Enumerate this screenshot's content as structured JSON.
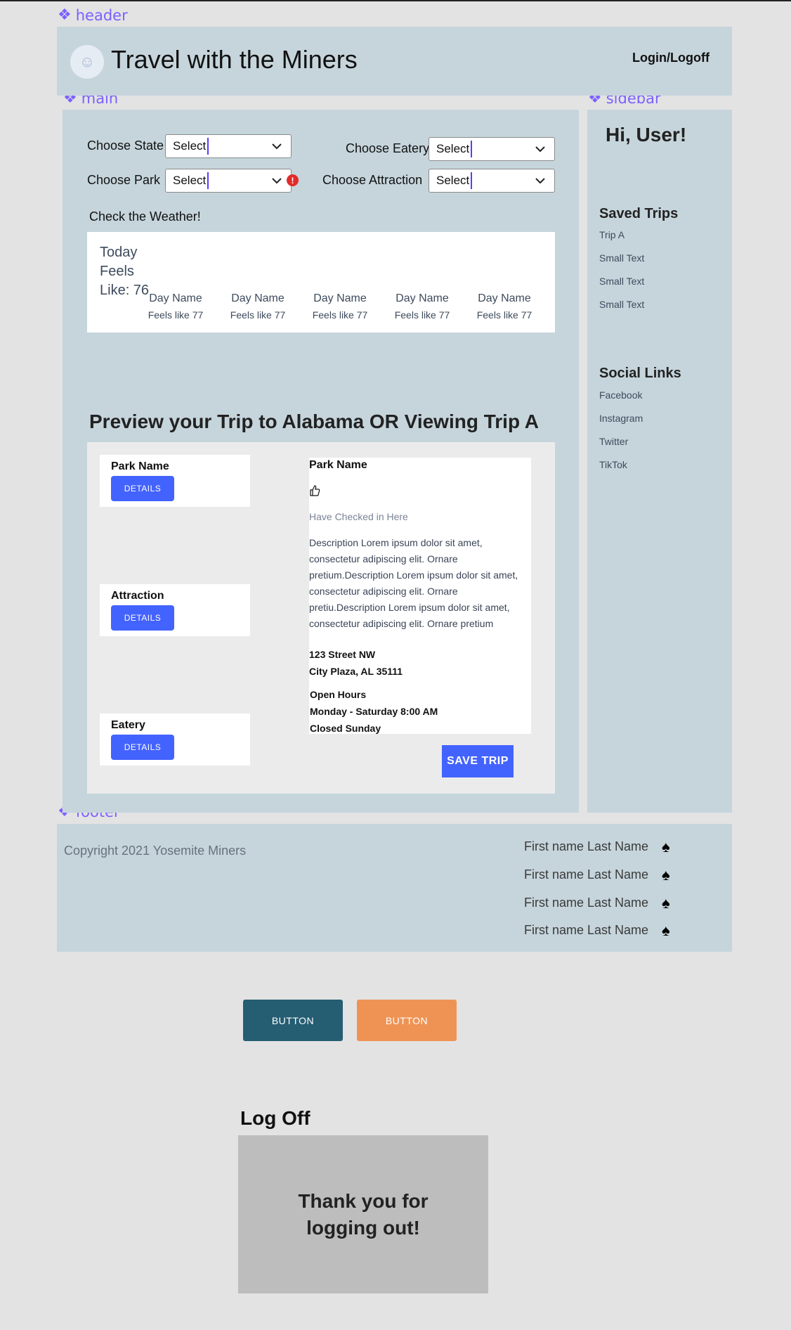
{
  "frame_tags": {
    "header": "header",
    "main": "main",
    "sidebar": "sidebar",
    "footer": "footer"
  },
  "header": {
    "title": "Travel with the Miners",
    "login": "Login/Logoff",
    "avatar_icon": "smiley-icon"
  },
  "filters": {
    "state": {
      "label": "Choose State",
      "value": "Select"
    },
    "park": {
      "label": "Choose Park",
      "value": "Select",
      "error": "!"
    },
    "eatery": {
      "label": "Choose Eatery",
      "value": "Select"
    },
    "attraction": {
      "label": "Choose Attraction",
      "value": "Select"
    }
  },
  "weather": {
    "heading": "Check the Weather!",
    "today": "Today Feels Like: 76",
    "days": [
      {
        "name": "Day Name",
        "feels": "Feels like 77"
      },
      {
        "name": "Day Name",
        "feels": "Feels like 77"
      },
      {
        "name": "Day Name",
        "feels": "Feels like 77"
      },
      {
        "name": "Day Name",
        "feels": "Feels like 77"
      },
      {
        "name": "Day Name",
        "feels": "Feels like 77"
      }
    ]
  },
  "preview": {
    "title": "Preview your Trip to Alabama OR Viewing Trip A",
    "cards": [
      {
        "title": "Park Name",
        "button": "DETAILS"
      },
      {
        "title": "Attraction",
        "button": "DETAILS"
      },
      {
        "title": "Eatery",
        "button": "DETAILS"
      }
    ],
    "detail": {
      "name": "Park Name",
      "thumb_icon": "thumbs-up-icon",
      "checked": "Have Checked in Here",
      "description": "Description Lorem ipsum dolor sit amet, consectetur adipiscing elit. Ornare pretium.Description Lorem ipsum dolor sit amet, consectetur adipiscing elit. Ornare pretiu.Description Lorem ipsum dolor sit amet, consectetur adipiscing elit. Ornare pretium",
      "address_line1": "123 Street NW",
      "address_line2": "City Plaza, AL 35111",
      "hours_title": "Open Hours",
      "hours_line1": "Monday - Saturday 8:00 AM",
      "hours_line2": "Closed Sunday"
    },
    "save_button": "SAVE  TRIP"
  },
  "sidebar": {
    "greeting": "Hi, User!",
    "saved_trips_title": "Saved Trips",
    "saved_trips": [
      "Trip A",
      "Small Text",
      "Small Text",
      "Small Text"
    ],
    "social_title": "Social Links",
    "social": [
      "Facebook",
      "Instagram",
      "Twitter",
      "TikTok"
    ]
  },
  "footer": {
    "copyright": "Copyright 2021 Yosemite Miners",
    "team": [
      "First name Last Name",
      "First name Last Name",
      "First name Last Name",
      "First name Last Name"
    ],
    "team_icon": "spade-icon"
  },
  "buttons": {
    "primary": "BUTTON",
    "secondary": "BUTTON"
  },
  "logoff": {
    "title": "Log Off",
    "message": "Thank you for logging out!"
  },
  "colors": {
    "panel": "#c6d5dc",
    "accent": "#4363ff",
    "frame_label": "#7b61ff",
    "button_dark": "#255d73",
    "button_orange": "#ee9354"
  }
}
